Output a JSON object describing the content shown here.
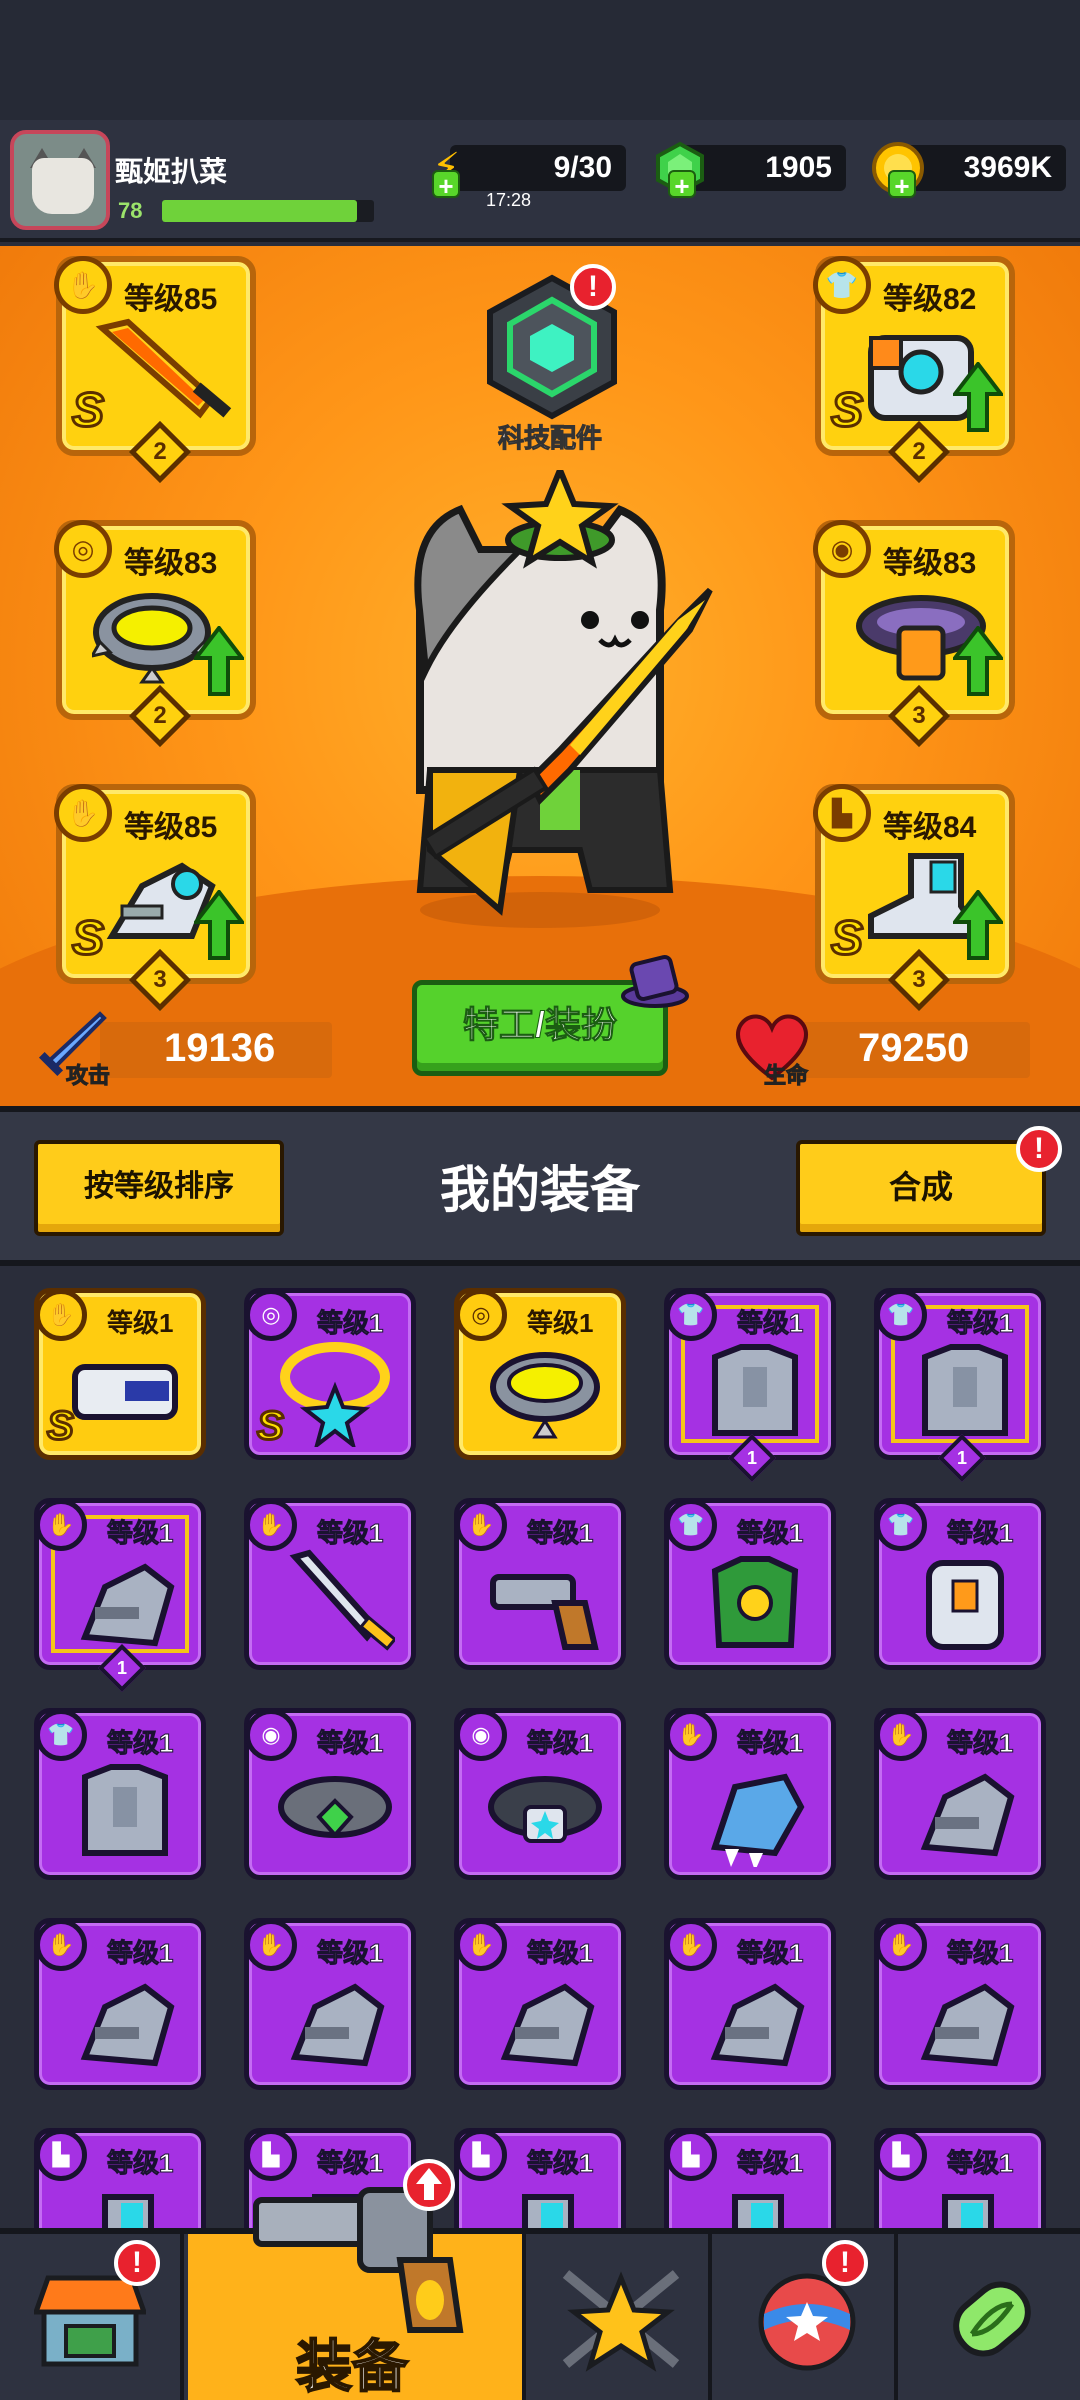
{
  "player": {
    "name": "甄姬扒菜",
    "level": "78",
    "xp_fraction": 0.92
  },
  "resources": {
    "energy": {
      "value": "9/30",
      "timer": "17:28",
      "icon": "lightning-icon"
    },
    "gems": {
      "value": "1905",
      "icon": "green-gem-icon"
    },
    "coins": {
      "value": "3969K",
      "icon": "gold-coin-icon"
    }
  },
  "tech": {
    "label": "科技配件",
    "alert": "!"
  },
  "equipped": {
    "weapon": {
      "level": "等级85",
      "grade": "S",
      "stars": "2",
      "type_icon": "gun-type-icon",
      "upgrade": false
    },
    "armor": {
      "level": "等级82",
      "grade": "S",
      "stars": "2",
      "type_icon": "shirt-type-icon",
      "upgrade": true
    },
    "necklace": {
      "level": "等级83",
      "grade": "",
      "stars": "2",
      "type_icon": "necklace-type-icon",
      "upgrade": true
    },
    "belt": {
      "level": "等级83",
      "grade": "",
      "stars": "3",
      "type_icon": "belt-type-icon",
      "upgrade": true
    },
    "glove": {
      "level": "等级85",
      "grade": "S",
      "stars": "3",
      "type_icon": "glove-type-icon",
      "upgrade": true
    },
    "boots": {
      "level": "等级84",
      "grade": "S",
      "stars": "3",
      "type_icon": "boot-type-icon",
      "upgrade": true
    }
  },
  "stats": {
    "attack": {
      "label": "攻击",
      "value": "19136"
    },
    "health": {
      "label": "生命",
      "value": "79250"
    }
  },
  "agent_button": "特工/装扮",
  "inventory": {
    "sort_label": "按等级排序",
    "title": "我的装备",
    "merge_label": "合成",
    "merge_alert": "!",
    "items": [
      {
        "level": "等级1",
        "rarity": "gold",
        "grade": "S",
        "stars": "",
        "type": "gun",
        "art": "visor"
      },
      {
        "level": "等级1",
        "rarity": "purple",
        "grade": "S",
        "stars": "",
        "type": "necklace",
        "art": "star-ring"
      },
      {
        "level": "等级1",
        "rarity": "gold",
        "grade": "",
        "stars": "",
        "type": "necklace",
        "art": "spike-ring"
      },
      {
        "level": "等级1",
        "rarity": "purple",
        "grade": "",
        "stars": "1",
        "type": "shirt",
        "art": "armor"
      },
      {
        "level": "等级1",
        "rarity": "purple",
        "grade": "",
        "stars": "1",
        "type": "shirt",
        "art": "armor"
      },
      {
        "level": "等级1",
        "rarity": "purple",
        "grade": "",
        "stars": "1",
        "type": "glove",
        "art": "glove"
      },
      {
        "level": "等级1",
        "rarity": "purple",
        "grade": "",
        "stars": "",
        "type": "gun",
        "art": "sword"
      },
      {
        "level": "等级1",
        "rarity": "purple",
        "grade": "",
        "stars": "",
        "type": "gun",
        "art": "revolver"
      },
      {
        "level": "等级1",
        "rarity": "purple",
        "grade": "",
        "stars": "",
        "type": "shirt",
        "art": "green-armor"
      },
      {
        "level": "等级1",
        "rarity": "purple",
        "grade": "",
        "stars": "",
        "type": "shirt",
        "art": "vest"
      },
      {
        "level": "等级1",
        "rarity": "purple",
        "grade": "",
        "stars": "",
        "type": "shirt",
        "art": "armor"
      },
      {
        "level": "等级1",
        "rarity": "purple",
        "grade": "",
        "stars": "",
        "type": "belt",
        "art": "green-belt"
      },
      {
        "level": "等级1",
        "rarity": "purple",
        "grade": "",
        "stars": "",
        "type": "belt",
        "art": "blue-belt"
      },
      {
        "level": "等级1",
        "rarity": "purple",
        "grade": "",
        "stars": "",
        "type": "glove",
        "art": "claw"
      },
      {
        "level": "等级1",
        "rarity": "purple",
        "grade": "",
        "stars": "",
        "type": "glove",
        "art": "glove"
      },
      {
        "level": "等级1",
        "rarity": "purple",
        "grade": "",
        "stars": "",
        "type": "glove",
        "art": "glove"
      },
      {
        "level": "等级1",
        "rarity": "purple",
        "grade": "",
        "stars": "",
        "type": "glove",
        "art": "glove"
      },
      {
        "level": "等级1",
        "rarity": "purple",
        "grade": "",
        "stars": "",
        "type": "glove",
        "art": "glove"
      },
      {
        "level": "等级1",
        "rarity": "purple",
        "grade": "",
        "stars": "",
        "type": "glove",
        "art": "glove"
      },
      {
        "level": "等级1",
        "rarity": "purple",
        "grade": "",
        "stars": "",
        "type": "glove",
        "art": "glove"
      },
      {
        "level": "等级1",
        "rarity": "purple",
        "grade": "",
        "stars": "",
        "type": "boot",
        "art": "boot"
      },
      {
        "level": "等级1",
        "rarity": "purple",
        "grade": "",
        "stars": "",
        "type": "boot",
        "art": "boot"
      },
      {
        "level": "等级1",
        "rarity": "purple",
        "grade": "",
        "stars": "",
        "type": "boot",
        "art": "boot"
      },
      {
        "level": "等级1",
        "rarity": "purple",
        "grade": "",
        "stars": "",
        "type": "boot",
        "art": "boot"
      },
      {
        "level": "等级1",
        "rarity": "purple",
        "grade": "",
        "stars": "",
        "type": "boot",
        "art": "boot"
      }
    ]
  },
  "nav": {
    "tabs": [
      {
        "name": "shop",
        "icon": "shop-icon",
        "alert": true
      },
      {
        "name": "equipment",
        "icon": "revolver-icon",
        "label": "装备",
        "active": true,
        "upgrade": true
      },
      {
        "name": "hero",
        "icon": "star-swords-icon",
        "alert": false
      },
      {
        "name": "planet",
        "icon": "star-planet-icon",
        "alert": true
      },
      {
        "name": "dna",
        "icon": "dna-capsule-icon",
        "alert": false
      }
    ],
    "active_label": "装备"
  },
  "colors": {
    "gold": "#ffcc10",
    "purple": "#a531e3",
    "orange": "#ff9618",
    "green": "#55d22c",
    "alert": "#e8222e"
  }
}
